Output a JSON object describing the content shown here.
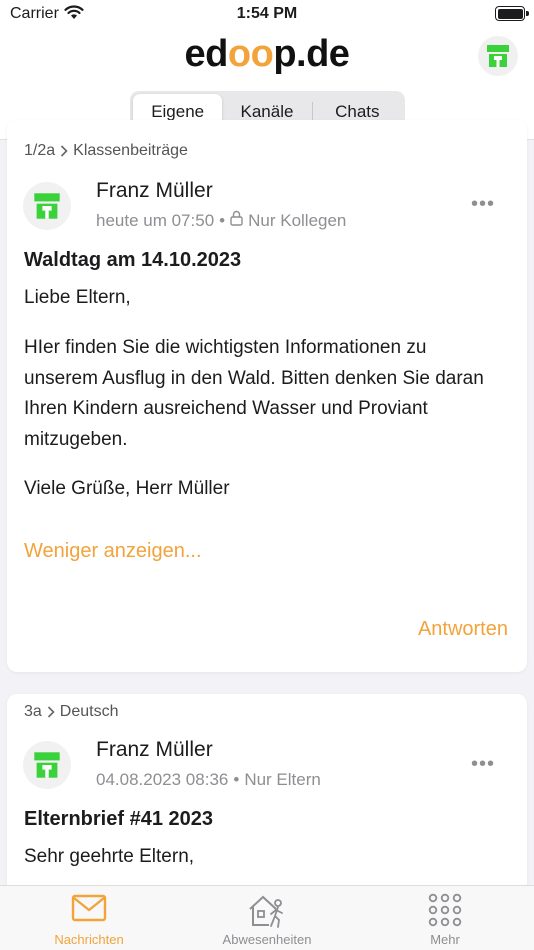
{
  "status_bar": {
    "carrier": "Carrier",
    "time": "1:54 PM"
  },
  "header": {
    "logo_left": "ed",
    "logo_oo": "oo",
    "logo_right": "p.de"
  },
  "segments": {
    "items": [
      "Eigene",
      "Kanäle",
      "Chats"
    ],
    "selected": "Eigene"
  },
  "posts": [
    {
      "breadcrumb_class": "1/2a",
      "breadcrumb_channel": "Klassenbeiträge",
      "author": "Franz Müller",
      "time": "heute um 07:50",
      "visibility": "Nur Kollegen",
      "title": "Waldtag am 14.10.2023",
      "greeting": "Liebe Eltern,",
      "body": "HIer finden Sie die wichtigsten Informationen zu unserem Ausflug in den Wald. Bitten denken Sie daran Ihren Kindern ausreichend Wasser und Proviant mitzugeben.",
      "signoff": "Viele Grüße, Herr Müller",
      "toggle": "Weniger anzeigen...",
      "reply": "Antworten"
    },
    {
      "breadcrumb_class": "3a",
      "breadcrumb_channel": "Deutsch",
      "author": "Franz Müller",
      "time": "04.08.2023 08:36",
      "visibility": "Nur Eltern",
      "title": "Elternbrief #41 2023",
      "greeting": "Sehr geehrte Eltern,"
    }
  ],
  "tabs": [
    {
      "label": "Nachrichten",
      "icon": "mail-icon",
      "active": true
    },
    {
      "label": "Abwesenheiten",
      "icon": "absence-icon",
      "active": false
    },
    {
      "label": "Mehr",
      "icon": "grid-icon",
      "active": false
    }
  ],
  "colors": {
    "accent": "#f2a33a",
    "avatar_green": "#3bd13b"
  }
}
